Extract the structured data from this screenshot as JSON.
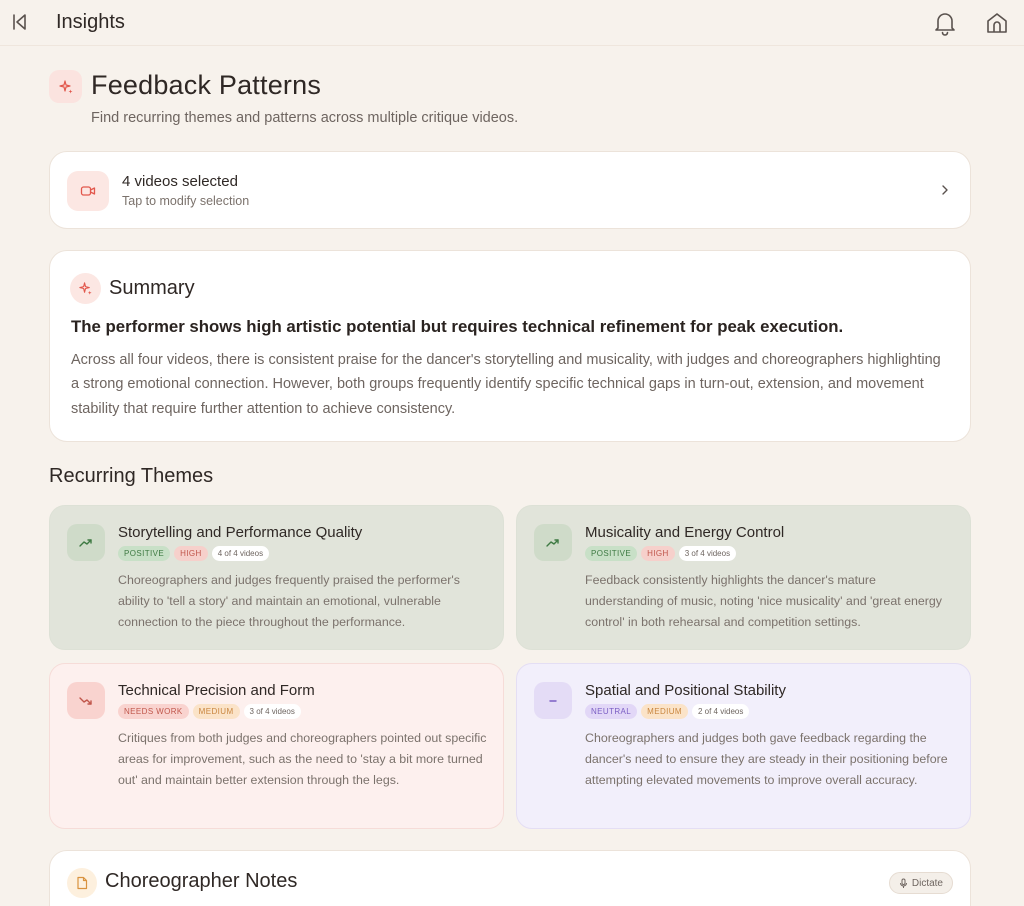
{
  "topbar": {
    "title": "Insights"
  },
  "header": {
    "title": "Feedback Patterns",
    "subtitle": "Find recurring themes and patterns across multiple critique videos."
  },
  "selection": {
    "title": "4 videos selected",
    "subtitle": "Tap to modify selection"
  },
  "summary": {
    "title": "Summary",
    "headline": "The performer shows high artistic potential but requires technical refinement for peak execution.",
    "body": "Across all four videos, there is consistent praise for the dancer's storytelling and musicality, with judges and choreographers highlighting a strong emotional connection. However, both groups frequently identify specific technical gaps in turn-out, extension, and movement stability that require further attention to achieve consistency."
  },
  "themes": {
    "title": "Recurring Themes",
    "items": [
      {
        "title": "Storytelling and Performance Quality",
        "sentiment": "POSITIVE",
        "priority": "HIGH",
        "count": "4 of 4 videos",
        "body": "Choreographers and judges frequently praised the performer's ability to 'tell a story' and maintain an emotional, vulnerable connection to the piece throughout the performance.",
        "icon": "trending-up-icon"
      },
      {
        "title": "Musicality and Energy Control",
        "sentiment": "POSITIVE",
        "priority": "HIGH",
        "count": "3 of 4 videos",
        "body": "Feedback consistently highlights the dancer's mature understanding of music, noting 'nice musicality' and 'great energy control' in both rehearsal and competition settings.",
        "icon": "trending-up-icon"
      },
      {
        "title": "Technical Precision and Form",
        "sentiment": "NEEDS WORK",
        "priority": "MEDIUM",
        "count": "3 of 4 videos",
        "body": "Critiques from both judges and choreographers pointed out specific areas for improvement, such as the need to 'stay a bit more turned out' and maintain better extension through the legs.",
        "icon": "trending-down-icon"
      },
      {
        "title": "Spatial and Positional Stability",
        "sentiment": "NEUTRAL",
        "priority": "MEDIUM",
        "count": "2 of 4 videos",
        "body": "Choreographers and judges both gave feedback regarding the dancer's need to ensure they are steady in their positioning before attempting elevated movements to improve overall accuracy.",
        "icon": "minus-icon"
      }
    ]
  },
  "notes": {
    "title": "Choreographer Notes",
    "dictate_label": "Dictate"
  },
  "colors": {
    "background": "#f7f2ec",
    "accent": "#e2574c",
    "positive": "#3e7a43",
    "negative": "#c0564b",
    "neutral": "#7b5ec4",
    "medium": "#c9853e"
  }
}
